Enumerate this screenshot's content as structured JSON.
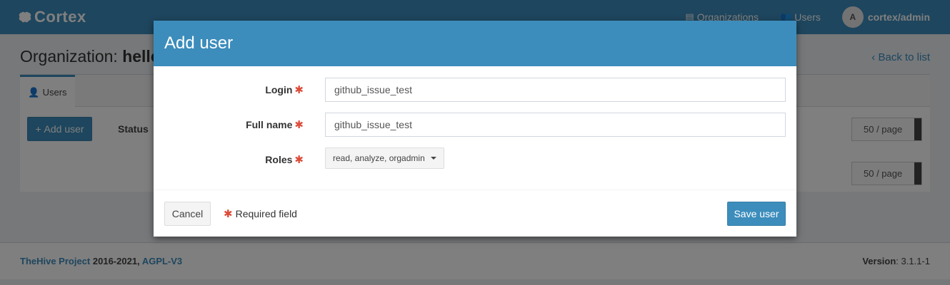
{
  "navbar": {
    "brand": "Cortex",
    "brand_icon": "brain-icon",
    "organizations_label": "Organizations",
    "users_label": "Users",
    "avatar_initial": "A",
    "user_name": "cortex/admin"
  },
  "page": {
    "title_prefix": "Organization:",
    "title_org": "hello",
    "back_label": "Back to list",
    "tab_users": "Users",
    "add_user_label": "Add user",
    "status_label": "Status",
    "per_page_top": "50 / page",
    "per_page_bottom": "50 / page"
  },
  "footer": {
    "project_link": "TheHive Project",
    "years": "2016-2021,",
    "license_link": "AGPL-V3",
    "version_label": "Version",
    "version_value": ": 3.1.1-1"
  },
  "modal": {
    "title": "Add user",
    "fields": {
      "login": {
        "label": "Login",
        "value": "github_issue_test"
      },
      "full_name": {
        "label": "Full name",
        "value": "github_issue_test"
      },
      "roles": {
        "label": "Roles",
        "value": "read, analyze, orgadmin"
      }
    },
    "required_marker": "✱",
    "cancel_label": "Cancel",
    "required_note": "Required field",
    "save_label": "Save user"
  },
  "colors": {
    "primary": "#3c8dbc",
    "required": "#dd4b39",
    "background": "#ecf0f5"
  }
}
